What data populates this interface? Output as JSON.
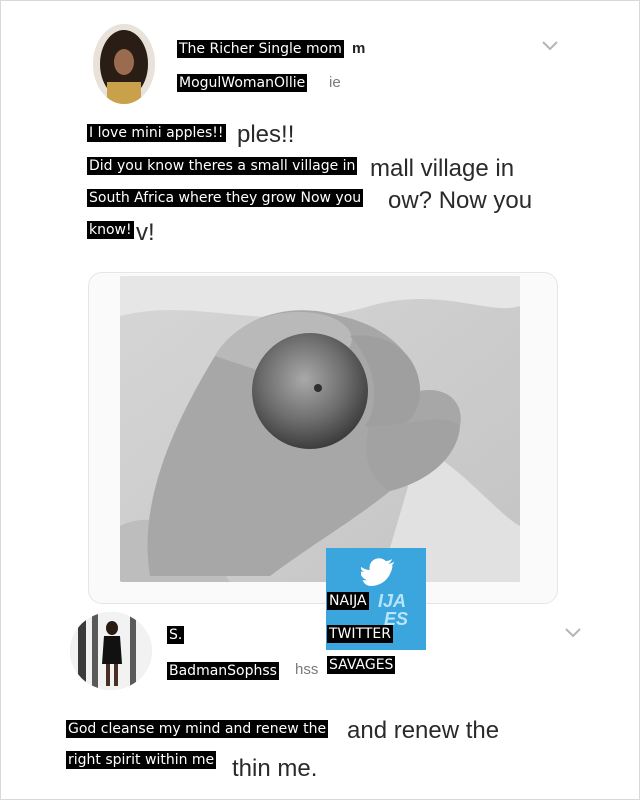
{
  "post1": {
    "display_name": "The Richer Single mom",
    "display_name_tail": "m",
    "handle": "MogulWomanOllie",
    "handle_tail": "ie",
    "text_lines": [
      "I love mini apples!!",
      "Did you know theres a small village in",
      "South Africa where they grow Now you",
      "know!"
    ],
    "ghost_lines": [
      "ples!!",
      "mall village in",
      "ow? Now you",
      "v!"
    ]
  },
  "watermark": {
    "lines": [
      "NAIJA",
      "TWITTER",
      "SAVAGES"
    ],
    "brand_color": "#3aa6dd",
    "icon": "bird-icon"
  },
  "post2": {
    "display_name": "S.",
    "handle": "BadmanSophss",
    "handle_tail": "hss",
    "text_lines": [
      "God cleanse my mind and renew the",
      "right spirit within me"
    ],
    "ghost_lines": [
      "and renew the",
      "thin me."
    ]
  },
  "icons": {
    "menu_chevron": "chevron-down-icon"
  }
}
